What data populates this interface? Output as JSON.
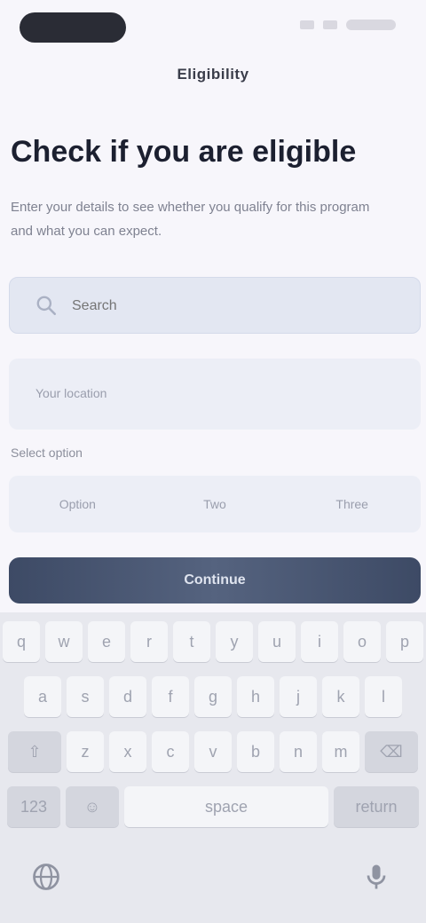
{
  "status_bar": {},
  "nav": {
    "title": "Eligibility"
  },
  "page": {
    "title": "Check if you are eligible",
    "description": "Enter your details to see whether you qualify for this program and what you can expect."
  },
  "search": {
    "placeholder": "Search",
    "value": ""
  },
  "info_card": {
    "text": "Your location"
  },
  "section": {
    "label": "Select option"
  },
  "segments": [
    "Option",
    "Two",
    "Three"
  ],
  "primary_button": {
    "label": "Continue"
  },
  "keyboard": {
    "row1": [
      "q",
      "w",
      "e",
      "r",
      "t",
      "y",
      "u",
      "i",
      "o",
      "p"
    ],
    "row2": [
      "a",
      "s",
      "d",
      "f",
      "g",
      "h",
      "j",
      "k",
      "l"
    ],
    "row3": [
      "z",
      "x",
      "c",
      "v",
      "b",
      "n",
      "m"
    ],
    "shift_label": "⇧",
    "delete_label": "⌫",
    "numbers_label": "123",
    "emoji_label": "☺",
    "space_label": "space",
    "return_label": "return"
  },
  "colors": {
    "accent": "#3d4a65",
    "background": "#f7f6fb",
    "field": "#e3e7f2"
  }
}
